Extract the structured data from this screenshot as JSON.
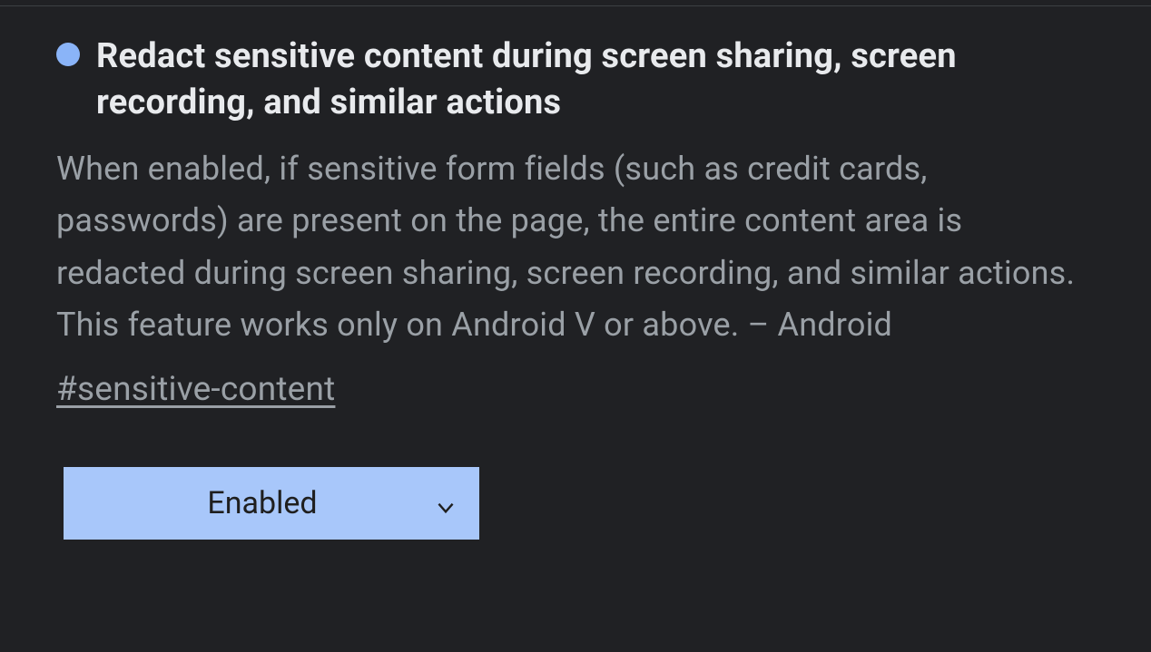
{
  "flag": {
    "title": "Redact sensitive content during screen sharing, screen recording, and similar actions",
    "description": "When enabled, if sensitive form fields (such as credit cards, passwords) are present on the page, the entire content area is redacted during screen sharing, screen recording, and similar actions. This feature works only on Android V or above. – Android",
    "hash": "#sensitive-content",
    "dropdown": {
      "selected": "Enabled"
    }
  },
  "colors": {
    "bullet": "#8ab4f8",
    "dropdown_bg": "#a8c7fa"
  }
}
